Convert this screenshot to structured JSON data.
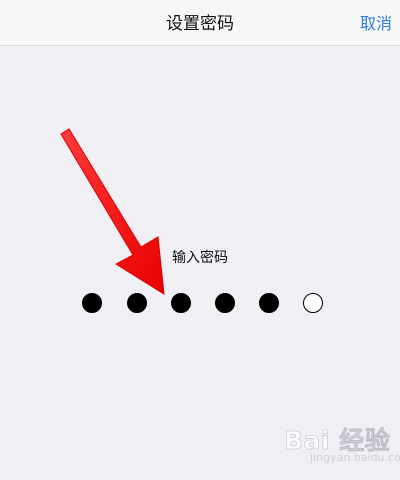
{
  "navbar": {
    "title": "设置密码",
    "cancel_label": "取消"
  },
  "passcode": {
    "prompt": "输入密码",
    "digits_total": 6,
    "digits_entered": 5
  },
  "annotation": {
    "arrow_color": "#ff1f1f"
  },
  "watermark": {
    "main": "Bai 经验",
    "sub": "jingyan.baidu.com"
  },
  "colors": {
    "background": "#efeff4",
    "navbar": "#f7f7f8",
    "accent": "#2f7be5"
  }
}
